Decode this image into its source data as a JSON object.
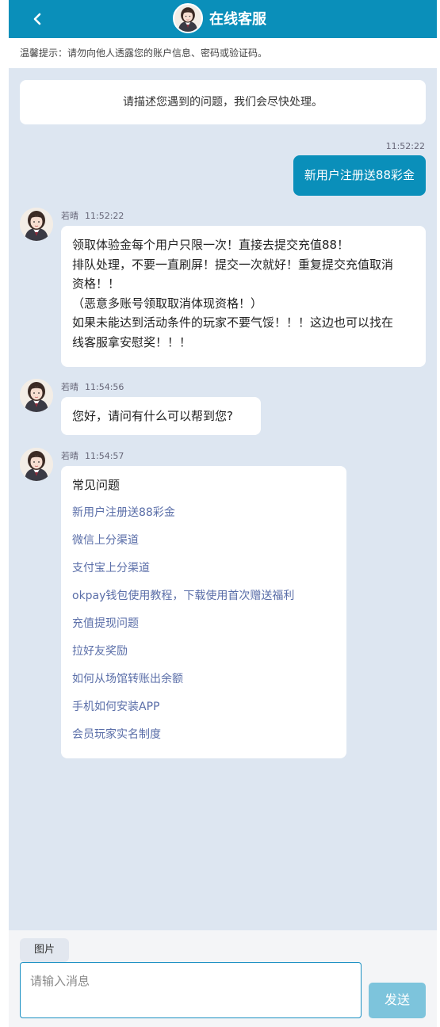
{
  "header": {
    "title": "在线客服",
    "back_icon": "chevron-left-icon"
  },
  "notice": "温馨提示：请勿向他人透露您的账户信息、密码或验证码。",
  "welcome": "请描述您遇到的问题，我们会尽快处理。",
  "messages": {
    "user": {
      "time": "11:52:22",
      "text": "新用户注册送88彩金"
    },
    "agent1": {
      "name": "若晴",
      "time": "11:52:22",
      "lines": [
        "领取体验金每个用户只限一次！直接去提交充值88！",
        "排队处理，不要一直刷屏！提交一次就好！重复提交充值取消",
        "资格！！",
        "（恶意多账号领取取消体现资格！）",
        "如果未能达到活动条件的玩家不要气馁！！！这边也可以找在",
        "线客服拿安慰奖！！！"
      ]
    },
    "agent2": {
      "name": "若晴",
      "time": "11:54:56",
      "text": "您好，请问有什么可以帮到您?"
    },
    "agent3": {
      "name": "若晴",
      "time": "11:54:57",
      "title": "常见问题",
      "links": [
        "新用户注册送88彩金",
        "微信上分渠道",
        "支付宝上分渠道",
        "okpay钱包使用教程，下载使用首次赠送福利",
        "充值提现问题",
        "拉好友奖励",
        "如何从场馆转账出余额",
        "手机如何安装APP",
        "会员玩家实名制度"
      ]
    }
  },
  "footer": {
    "image_button": "图片",
    "input_placeholder": "请输入消息",
    "send_button": "发送"
  },
  "colors": {
    "primary": "#0a8fba",
    "background": "#dde6f1",
    "link": "#5a6ea8",
    "send_disabled": "#7dc4dc"
  }
}
